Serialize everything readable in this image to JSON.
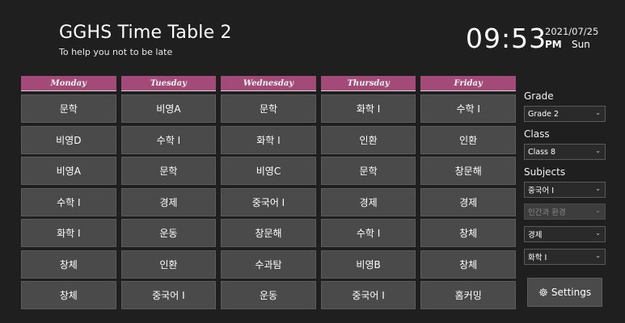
{
  "header": {
    "title": "GGHS Time Table 2",
    "subtitle": "To help you not to be late",
    "time": "09:53",
    "date": "2021/07/25",
    "ampm": "PM",
    "weekday": "Sun"
  },
  "timetable": {
    "days": [
      "Monday",
      "Tuesday",
      "Wednesday",
      "Thursday",
      "Friday"
    ],
    "rows": [
      [
        "문학",
        "비영A",
        "문학",
        "화학 I",
        "수학 I"
      ],
      [
        "비영D",
        "수학 I",
        "화학 I",
        "인환",
        "인환"
      ],
      [
        "비영A",
        "문학",
        "비영C",
        "문학",
        "창문해"
      ],
      [
        "수학 I",
        "경제",
        "중국어 I",
        "경제",
        "경제"
      ],
      [
        "화학 I",
        "운동",
        "창문해",
        "수학 I",
        "창체"
      ],
      [
        "창체",
        "인환",
        "수과탐",
        "비영B",
        "창체"
      ],
      [
        "창체",
        "중국어 I",
        "운동",
        "중국어 I",
        "홈커밍"
      ]
    ]
  },
  "sidebar": {
    "grade_label": "Grade",
    "grade_value": "Grade 2",
    "class_label": "Class",
    "class_value": "Class 8",
    "subjects_label": "Subjects",
    "subjects": [
      "중국어 I",
      "인간과 환경",
      "경제",
      "화학 I"
    ],
    "settings_label": "Settings"
  },
  "colors": {
    "background": "#1f1f1f",
    "header_accent": "#a34a78",
    "cell": "#4a4a4a"
  }
}
